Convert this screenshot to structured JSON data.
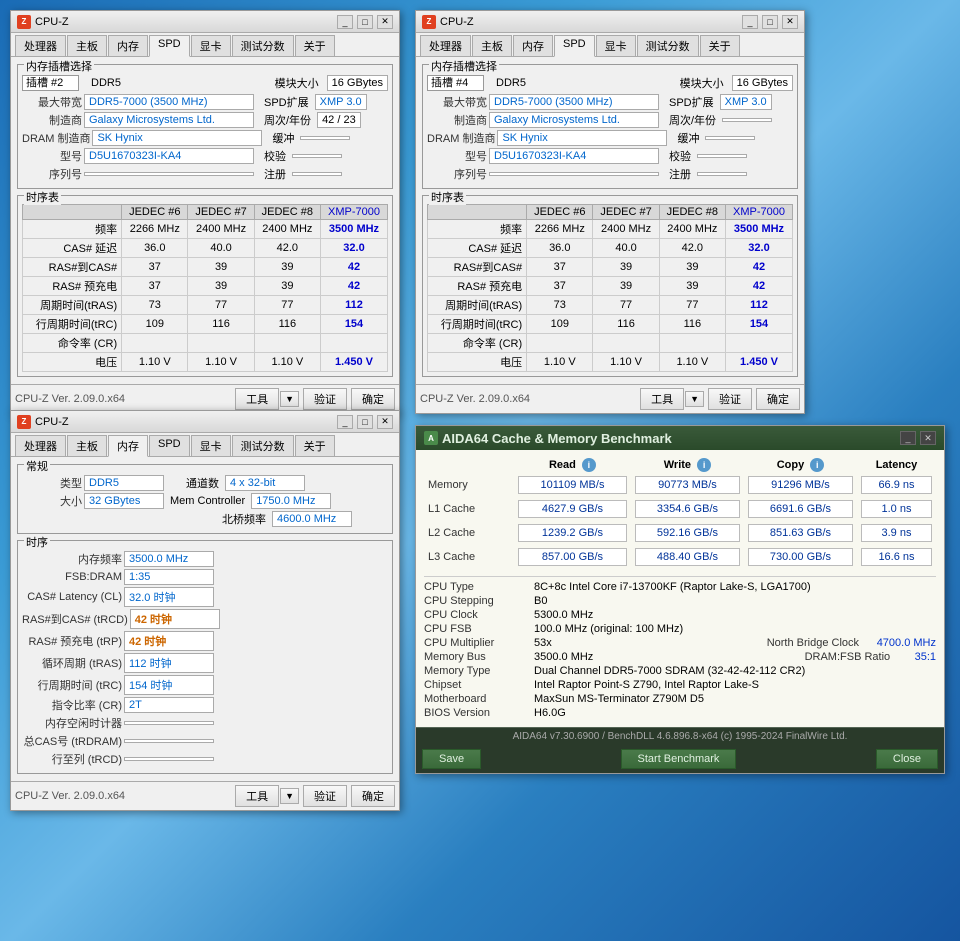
{
  "cpuz1": {
    "title": "CPU-Z",
    "tabs": [
      "处理器",
      "主板",
      "内存",
      "SPD",
      "显卡",
      "测试分数",
      "关于"
    ],
    "active_tab": "SPD",
    "section_slot": "内存插槽选择",
    "slot_label": "插槽 #2",
    "ddr": "DDR5",
    "module_size_label": "模块大小",
    "module_size_value": "16 GBytes",
    "max_bw_label": "最大带宽",
    "max_bw_value": "DDR5-7000 (3500 MHz)",
    "spd_ext_label": "SPD扩展",
    "spd_ext_value": "XMP 3.0",
    "maker_label": "制造商",
    "maker_value": "Galaxy Microsystems Ltd.",
    "weeks_label": "周次/年份",
    "weeks_value": "42 / 23",
    "dram_maker_label": "DRAM 制造商",
    "dram_maker_value": "SK Hynix",
    "check_label": "缓冲",
    "check_value": "",
    "model_label": "型号",
    "model_value": "D5U1670323I-KA4",
    "verify_label": "校验",
    "verify_value": "",
    "serial_label": "序列号",
    "serial_value": "",
    "note_label": "注册",
    "note_value": "",
    "timing_section": "时序表",
    "timing_headers": [
      "JEDEC #6",
      "JEDEC #7",
      "JEDEC #8",
      "XMP-7000"
    ],
    "timing_rows": [
      {
        "label": "频率",
        "values": [
          "2266 MHz",
          "2400 MHz",
          "2400 MHz",
          "3500 MHz"
        ]
      },
      {
        "label": "CAS# 延迟",
        "values": [
          "36.0",
          "40.0",
          "42.0",
          "32.0"
        ]
      },
      {
        "label": "RAS#到CAS#",
        "values": [
          "37",
          "39",
          "39",
          "42"
        ]
      },
      {
        "label": "RAS# 预充电",
        "values": [
          "37",
          "39",
          "39",
          "42"
        ]
      },
      {
        "label": "周期时间(tRAS)",
        "values": [
          "73",
          "77",
          "77",
          "112"
        ]
      },
      {
        "label": "行周期时间(tRC)",
        "values": [
          "109",
          "116",
          "116",
          "154"
        ]
      },
      {
        "label": "命令率 (CR)",
        "values": [
          "",
          "",
          "",
          ""
        ]
      },
      {
        "label": "电压",
        "values": [
          "1.10 V",
          "1.10 V",
          "1.10 V",
          "1.450 V"
        ]
      }
    ],
    "ver": "CPU-Z  Ver. 2.09.0.x64",
    "btn_tool": "工具",
    "btn_verify": "验证",
    "btn_ok": "确定"
  },
  "cpuz2": {
    "title": "CPU-Z",
    "tabs": [
      "处理器",
      "主板",
      "内存",
      "SPD",
      "显卡",
      "测试分数",
      "关于"
    ],
    "active_tab": "SPD",
    "section_slot": "内存插槽选择",
    "slot_label": "插槽 #4",
    "ddr": "DDR5",
    "module_size_label": "模块大小",
    "module_size_value": "16 GBytes",
    "max_bw_label": "最大带宽",
    "max_bw_value": "DDR5-7000 (3500 MHz)",
    "spd_ext_label": "SPD扩展",
    "spd_ext_value": "XMP 3.0",
    "maker_label": "制造商",
    "maker_value": "Galaxy Microsystems Ltd.",
    "weeks_label": "周次/年份",
    "weeks_value": "",
    "dram_maker_label": "DRAM 制造商",
    "dram_maker_value": "SK Hynix",
    "check_label": "缓冲",
    "check_value": "",
    "model_label": "型号",
    "model_value": "D5U1670323I-KA4",
    "verify_label": "校验",
    "verify_value": "",
    "serial_label": "序列号",
    "serial_value": "",
    "note_label": "注册",
    "note_value": "",
    "timing_section": "时序表",
    "timing_headers": [
      "JEDEC #6",
      "JEDEC #7",
      "JEDEC #8",
      "XMP-7000"
    ],
    "timing_rows": [
      {
        "label": "频率",
        "values": [
          "2266 MHz",
          "2400 MHz",
          "2400 MHz",
          "3500 MHz"
        ]
      },
      {
        "label": "CAS# 延迟",
        "values": [
          "36.0",
          "40.0",
          "42.0",
          "32.0"
        ]
      },
      {
        "label": "RAS#到CAS#",
        "values": [
          "37",
          "39",
          "39",
          "42"
        ]
      },
      {
        "label": "RAS# 预充电",
        "values": [
          "37",
          "39",
          "39",
          "42"
        ]
      },
      {
        "label": "周期时间(tRAS)",
        "values": [
          "73",
          "77",
          "77",
          "112"
        ]
      },
      {
        "label": "行周期时间(tRC)",
        "values": [
          "109",
          "116",
          "116",
          "154"
        ]
      },
      {
        "label": "命令率 (CR)",
        "values": [
          "",
          "",
          "",
          ""
        ]
      },
      {
        "label": "电压",
        "values": [
          "1.10 V",
          "1.10 V",
          "1.10 V",
          "1.450 V"
        ]
      }
    ],
    "ver": "CPU-Z  Ver. 2.09.0.x64",
    "btn_tool": "工具",
    "btn_verify": "验证",
    "btn_ok": "确定"
  },
  "cpuz3": {
    "title": "CPU-Z",
    "tabs": [
      "处理器",
      "主板",
      "内存",
      "SPD",
      "显卡",
      "测试分数",
      "关于"
    ],
    "active_tab": "内存",
    "section_common": "常规",
    "type_label": "类型",
    "type_value": "DDR5",
    "channels_label": "通道数",
    "channels_value": "4 x 32-bit",
    "size_label": "大小",
    "size_value": "32 GBytes",
    "mem_controller_label": "Mem Controller",
    "mem_controller_value": "1750.0 MHz",
    "north_bridge_label": "北桥频率",
    "north_bridge_value": "4600.0 MHz",
    "timing_section": "时序",
    "freq_label": "内存频率",
    "freq_value": "3500.0 MHz",
    "fsb_label": "FSB:DRAM",
    "fsb_value": "1:35",
    "cas_label": "CAS# Latency (CL)",
    "cas_value": "32.0 时钟",
    "rcd_label": "RAS#到CAS# (tRCD)",
    "rcd_value": "42 时钟",
    "rp_label": "RAS# 预充电 (tRP)",
    "rp_value": "42 时钟",
    "tras_label": "循环周期 (tRAS)",
    "tras_value": "112 时钟",
    "trc_label": "行周期时间 (tRC)",
    "trc_value": "154 时钟",
    "cr_label": "指令比率 (CR)",
    "cr_value": "2T",
    "cas_banks_label": "内存空闲时计器",
    "cas_banks_value": "",
    "total_cas_label": "总CAS号 (tRDRAM)",
    "total_cas_value": "",
    "row_label": "行至列 (tRCD)",
    "row_value": "",
    "ver": "CPU-Z  Ver. 2.09.0.x64",
    "btn_tool": "工具",
    "btn_verify": "验证",
    "btn_ok": "确定"
  },
  "aida": {
    "title": "AIDA64 Cache & Memory Benchmark",
    "col_read": "Read",
    "col_write": "Write",
    "col_copy": "Copy",
    "col_latency": "Latency",
    "rows": [
      {
        "label": "Memory",
        "read": "101109 MB/s",
        "write": "90773 MB/s",
        "copy": "91296 MB/s",
        "latency": "66.9 ns"
      },
      {
        "label": "L1 Cache",
        "read": "4627.9 GB/s",
        "write": "3354.6 GB/s",
        "copy": "6691.6 GB/s",
        "latency": "1.0 ns"
      },
      {
        "label": "L2 Cache",
        "read": "1239.2 GB/s",
        "write": "592.16 GB/s",
        "copy": "851.63 GB/s",
        "latency": "3.9 ns"
      },
      {
        "label": "L3 Cache",
        "read": "857.00 GB/s",
        "write": "488.40 GB/s",
        "copy": "730.00 GB/s",
        "latency": "16.6 ns"
      }
    ],
    "info_rows": [
      {
        "label": "CPU Type",
        "value": "8C+8c Intel Core i7-13700KF  (Raptor Lake-S, LGA1700)"
      },
      {
        "label": "CPU Stepping",
        "value": "B0"
      },
      {
        "label": "CPU Clock",
        "value": "5300.0 MHz"
      },
      {
        "label": "CPU FSB",
        "value": "100.0 MHz  (original: 100 MHz)"
      },
      {
        "label": "CPU Multiplier",
        "value": "53x",
        "extra_label": "North Bridge Clock",
        "extra_value": "4700.0 MHz"
      },
      {
        "label": "Memory Bus",
        "value": "3500.0 MHz",
        "extra_label": "DRAM:FSB Ratio",
        "extra_value": "35:1"
      },
      {
        "label": "Memory Type",
        "value": "Dual Channel DDR5-7000 SDRAM  (32-42-42-112 CR2)"
      },
      {
        "label": "Chipset",
        "value": "Intel Raptor Point-S Z790, Intel Raptor Lake-S"
      },
      {
        "label": "Motherboard",
        "value": "MaxSun MS-Terminator Z790M D5"
      },
      {
        "label": "BIOS Version",
        "value": "H6.0G"
      }
    ],
    "status_text": "AIDA64 v7.30.6900 / BenchDLL 4.6.896.8-x64  (c) 1995-2024 FinalWire Ltd.",
    "btn_save": "Save",
    "btn_start": "Start Benchmark",
    "btn_close": "Close"
  }
}
